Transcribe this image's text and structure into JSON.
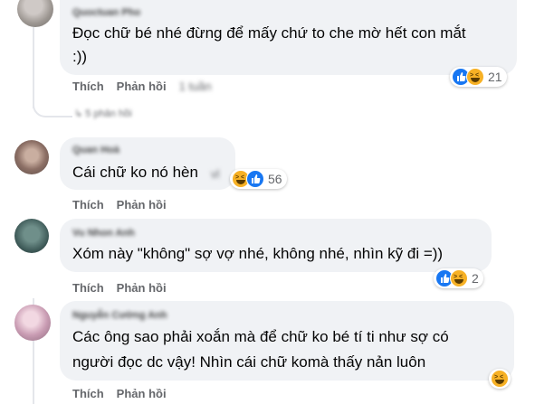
{
  "comments": [
    {
      "author": "Quoctuan Pho",
      "text_lines": [
        "Đọc chữ bé nhé đừng để mấy chứ to che mờ hết con mắt",
        ":))"
      ],
      "reactions": [
        "like",
        "haha"
      ],
      "reaction_count": "21",
      "actions": {
        "like": "Thích",
        "reply": "Phản hồi",
        "time": "1 tuần"
      }
    },
    {
      "author": "Quan Hoà",
      "text_lines": [
        "Cái chữ ko nó hèn",
        "vl"
      ],
      "reactions": [
        "haha",
        "like"
      ],
      "reaction_count": "56",
      "actions": {
        "like": "Thích",
        "reply": "Phản hồi"
      }
    },
    {
      "author": "Vu Nhon Anh",
      "text_lines": [
        "Xóm này \"không\" sợ vợ nhé, không nhé, nhìn kỹ đi =))"
      ],
      "reactions": [
        "like",
        "haha"
      ],
      "reaction_count": "2",
      "actions": {
        "like": "Thích",
        "reply": "Phản hồi"
      }
    },
    {
      "author": "Nguyễn Cường Anh",
      "text_lines": [
        "Các ông sao phải xoắn mà để chữ ko bé tí ti như sợ có",
        "người đọc dc vậy! Nhìn cái chữ komà thấy nản luôn"
      ],
      "reactions": [
        "haha"
      ],
      "reaction_count": "",
      "actions": {
        "like": "Thích",
        "reply": "Phản hồi"
      }
    }
  ],
  "collapsed_replies": "↳ 5 phản hồi",
  "colors": {
    "like_blue": "#1877f2",
    "haha_yellow": "#f7b125",
    "bubble": "#f0f2f5",
    "meta_gray": "#65676b"
  }
}
